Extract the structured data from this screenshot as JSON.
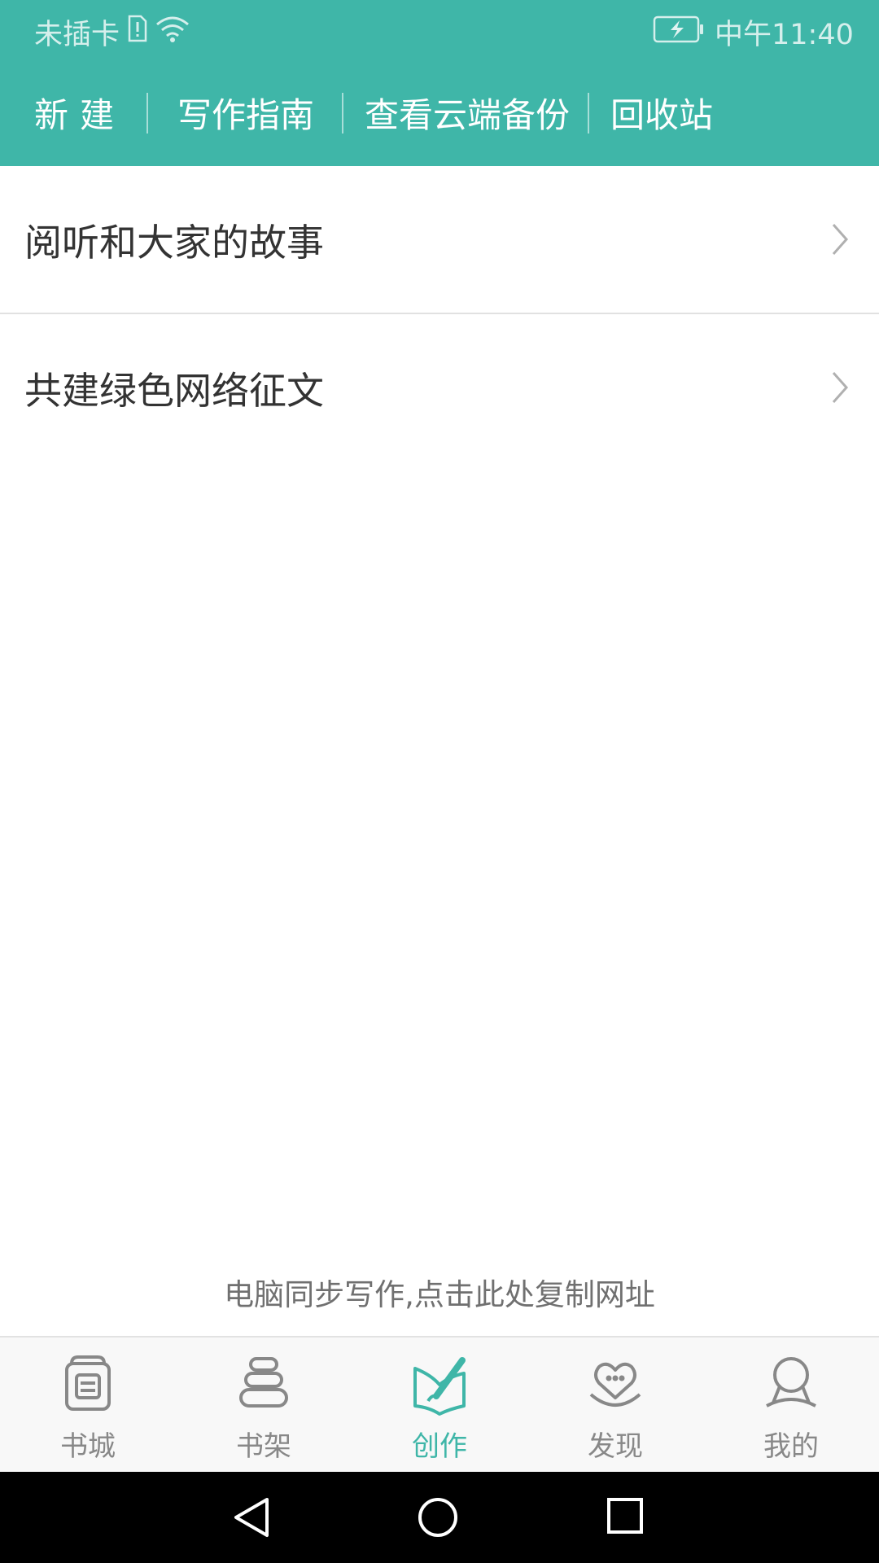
{
  "status_bar": {
    "carrier": "未插卡",
    "time": "中午11:40"
  },
  "actions": {
    "new": "新建",
    "guide": "写作指南",
    "cloud_backup": "查看云端备份",
    "recycle_bin": "回收站"
  },
  "list": [
    {
      "label": "阅听和大家的故事"
    },
    {
      "label": "共建绿色网络征文"
    }
  ],
  "sync_link": "电脑同步写作,点击此处复制网址",
  "tabs": [
    {
      "label": "书城",
      "icon": "bookstore-icon"
    },
    {
      "label": "书架",
      "icon": "bookshelf-icon"
    },
    {
      "label": "创作",
      "icon": "create-icon",
      "active": true
    },
    {
      "label": "发现",
      "icon": "discover-icon"
    },
    {
      "label": "我的",
      "icon": "profile-icon"
    }
  ],
  "colors": {
    "accent": "#3fb6a8",
    "inactive_tab": "#888888",
    "list_text": "#333333"
  }
}
